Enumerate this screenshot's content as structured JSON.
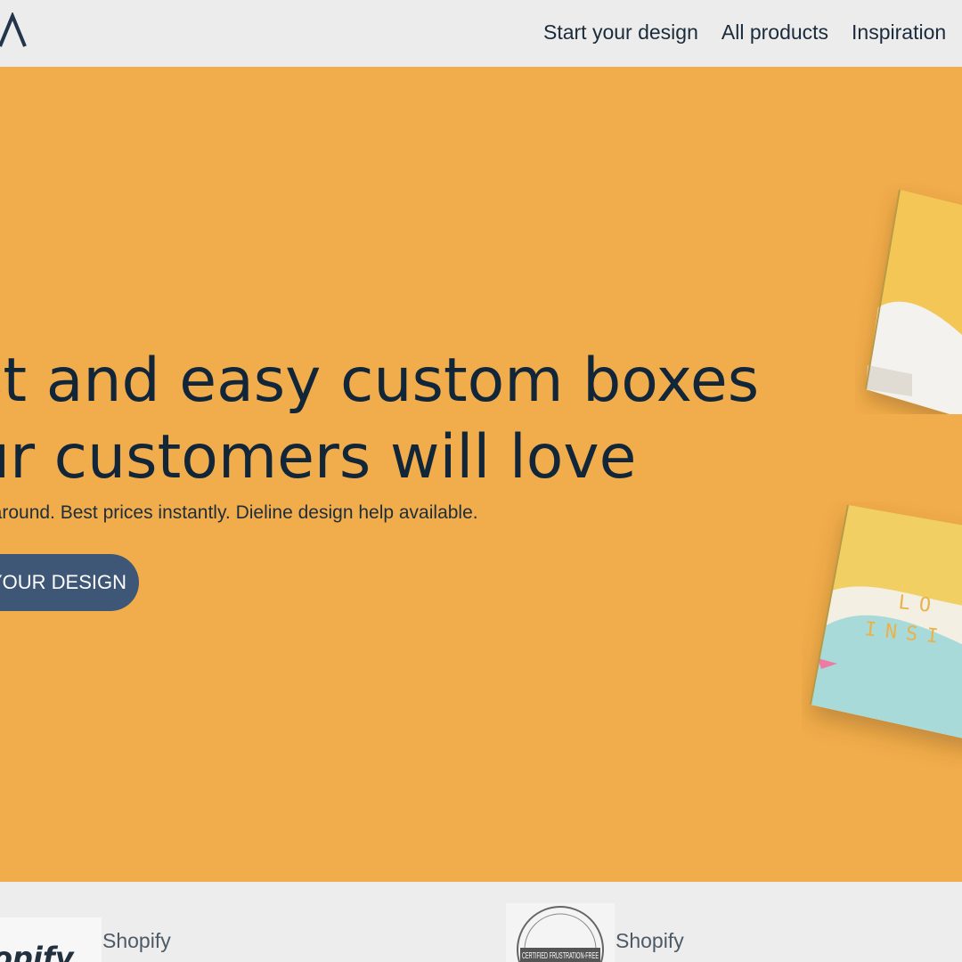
{
  "nav": {
    "links": [
      "Start your design",
      "All products",
      "Inspiration"
    ]
  },
  "hero": {
    "headline_line1": "st and easy custom boxes",
    "headline_line2": "ur customers will love",
    "subline": "rnaround. Best prices instantly. Dieline design help available.",
    "cta_label": "YOUR DESIGN",
    "box_print_top": "LO",
    "box_print_bottom": "INSI"
  },
  "partners": [
    {
      "logo_text": "opify",
      "name": "Shopify"
    },
    {
      "logo_text": "CERTIFIED FRUSTRATION-FREE",
      "name": "Shopify"
    }
  ],
  "colors": {
    "hero_bg": "#f1ac4b",
    "headline": "#12263a",
    "cta_bg": "#3e5777",
    "nav_bg": "#ececec"
  }
}
